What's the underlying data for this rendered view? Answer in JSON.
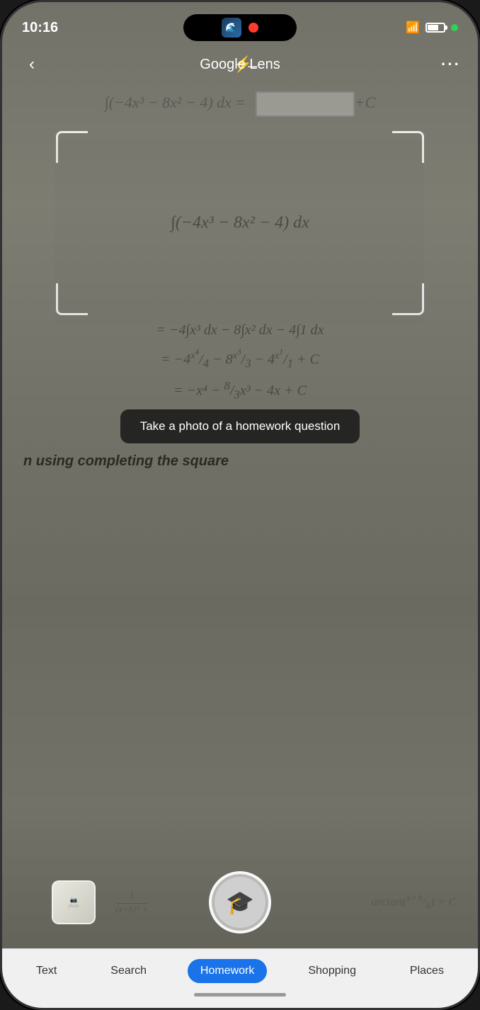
{
  "statusBar": {
    "time": "10:16",
    "greenDot": true
  },
  "header": {
    "title": "Google Lens",
    "backLabel": "‹",
    "flashLabel": "⚡",
    "moreLabel": "···"
  },
  "math": {
    "topEquation": "∫(−4x³ − 8x² − 4) dx =",
    "insideViewfinder": "∫(−4x³ − 8x² − 4) dx",
    "line1": "= −4∫x³ dx − 8∫x² dx − 4∫1 dx",
    "line2": "= −4(x⁴/4) − 8(x³/3) − 4(x/1) + C",
    "line3": "= −x⁴ − (8/3)x³ − 4x + C",
    "fractionBottom": "1/((x+h)² + ...) arctan((x+h)/k) + C"
  },
  "tooltip": {
    "text": "Take a photo of a homework question"
  },
  "completingSquare": {
    "text": "n using completing the square"
  },
  "tabs": [
    {
      "id": "text",
      "label": "Text",
      "active": false
    },
    {
      "id": "search",
      "label": "Search",
      "active": false
    },
    {
      "id": "homework",
      "label": "Homework",
      "active": true
    },
    {
      "id": "shopping",
      "label": "Shopping",
      "active": false
    },
    {
      "id": "places",
      "label": "Places",
      "active": false
    }
  ],
  "icons": {
    "back": "chevron-left-icon",
    "flash": "flash-off-icon",
    "more": "more-options-icon",
    "graduation": "graduation-cap-icon",
    "wifi": "wifi-icon",
    "battery": "battery-icon",
    "recordDot": "record-dot-icon"
  }
}
